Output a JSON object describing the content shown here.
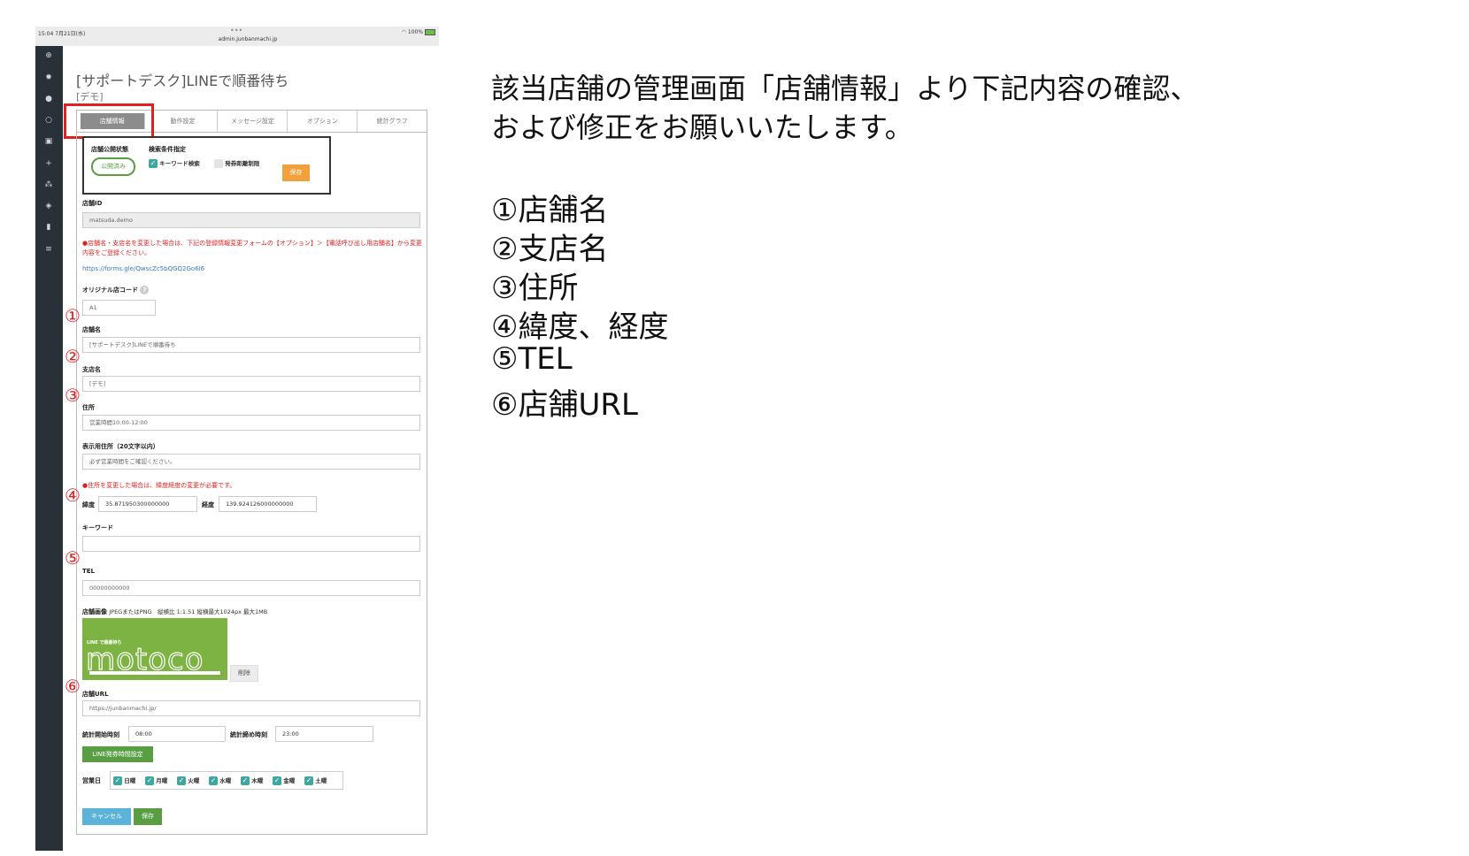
{
  "statusbar": {
    "time": "15:04  7月21日(水)",
    "url": "admin.junbanmachi.jp",
    "battery": "100%",
    "dots": "•••"
  },
  "app": {
    "title": "[サポートデスク]LINEで順番待ち",
    "subtitle": "[デモ]"
  },
  "tabs": [
    "店舗情報",
    "動作設定",
    "メッセージ設定",
    "オプション",
    "統計グラフ"
  ],
  "publish": {
    "status_label": "店舗公開状態",
    "status_value": "公開済み",
    "search_label": "検索条件指定",
    "keyword_search": "キーワード検索",
    "distance_limit": "発券距離制限",
    "save": "保存"
  },
  "fields": {
    "store_id_label": "店舗ID",
    "store_id_value": "matsuda.demo",
    "warning1": "●店舗名・支店名を変更した場合は、下記の登録情報変更フォームの【オプション】＞【電話呼び出し用店舗名】から変更内容をご登録ください。",
    "form_link": "https://forms.gle/QwscZc5bQGQ2Go6i6",
    "orig_code_label": "オリジナル店コード",
    "orig_code_value": "A1",
    "store_name_label": "店舗名",
    "store_name_value": "[サポートデスク]LINEで順番待ち",
    "branch_label": "支店名",
    "branch_value": "[デモ]",
    "address_label": "住所",
    "address_value": "営業時間10:00-12:00",
    "disp_address_label": "表示用住所（20文字以内）",
    "disp_address_value": "必ず営業時間をご確認ください。",
    "warning2": "●住所を変更した場合は、緯度経度の変更が必要です。",
    "lat_label": "緯度",
    "lat_value": "35.871950300000000",
    "lng_label": "経度",
    "lng_value": "139.924126000000000",
    "keyword_label": "キーワード",
    "tel_label": "TEL",
    "tel_value": "00000000000",
    "image_label": "店舗画像",
    "image_hint": "JPEGまたはPNG　縦横比 1:1.51 縦横最大1024px 最大1MB",
    "image_text": "motoco",
    "image_caption": "LINE で順番待ち",
    "delete": "削除",
    "url_label": "店舗URL",
    "url_value": "https://junbanmachi.jp/",
    "stat_start_label": "統計開始時刻",
    "stat_start_value": "08:00",
    "stat_end_label": "統計締め時刻",
    "stat_end_value": "23:00",
    "line_time_btn": "LINE発券時間設定",
    "business_days_label": "営業日",
    "days": [
      "日曜",
      "月曜",
      "火曜",
      "水曜",
      "木曜",
      "金曜",
      "土曜"
    ],
    "cancel": "キャンセル",
    "save": "保存"
  },
  "markers": [
    "①",
    "②",
    "③",
    "④",
    "⑤",
    "⑥"
  ],
  "instruction": {
    "line1": "該当店舗の管理画面「店舗情報」より下記内容の確認、",
    "line2": "および修正をお願いいたします。",
    "items": [
      "①店舗名",
      "②支店名",
      "③住所",
      "④緯度、経度",
      "⑤TEL",
      "⑥店舗URL"
    ]
  },
  "colors": {
    "marker": "#e02020",
    "sidebar": "#283137",
    "green": "#5a9e44",
    "orange": "#f0a13b",
    "blue": "#5bb3d9"
  }
}
